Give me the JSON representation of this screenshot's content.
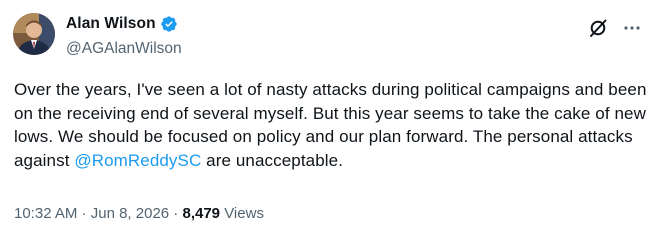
{
  "author": {
    "name": "Alan Wilson",
    "handle": "@AGAlanWilson",
    "verified_color": "#1d9bf0"
  },
  "header_actions": {
    "grok_icon": "slashed-circle-icon",
    "more_icon": "ellipsis-icon"
  },
  "tweet": {
    "text_before_mention": "Over the years, I've seen a lot of nasty attacks during political campaigns and been on the receiving end of several myself. But this year seems to take the cake of new lows. We should be focused on policy and our plan forward. The personal attacks against ",
    "mention": "@RomReddySC",
    "text_after_mention": " are unacceptable."
  },
  "meta": {
    "time": "10:32 AM",
    "separator": " · ",
    "date": "Jun 8, 2026",
    "views_count": "8,479",
    "views_label": " Views"
  },
  "colors": {
    "text": "#0f1419",
    "secondary": "#536471",
    "link": "#1d9bf0"
  }
}
